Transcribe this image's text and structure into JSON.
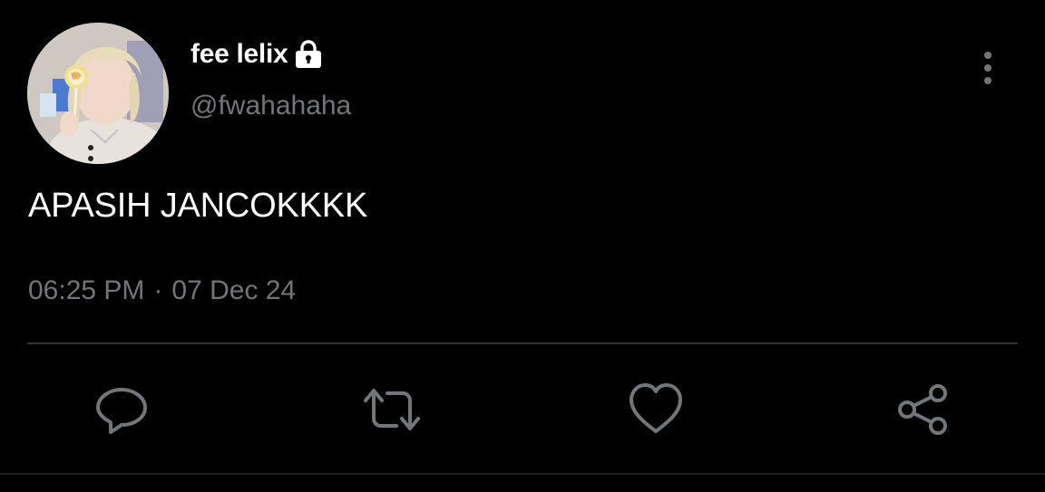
{
  "tweet": {
    "display_name": "fee lelix",
    "handle": "@fwahahaha",
    "text": "APASIH JANCOKKKK",
    "time": "06:25 PM",
    "separator": "·",
    "date": "07 Dec 24",
    "protected": true
  },
  "icons": {
    "lock": "lock-icon",
    "more": "more-vertical-icon",
    "reply": "reply-icon",
    "retweet": "retweet-icon",
    "like": "heart-icon",
    "share": "share-icon"
  },
  "colors": {
    "background": "#000000",
    "primary_text": "#ffffff",
    "secondary_text": "#71767b",
    "divider": "#2f3336",
    "icon": "#71767b"
  }
}
